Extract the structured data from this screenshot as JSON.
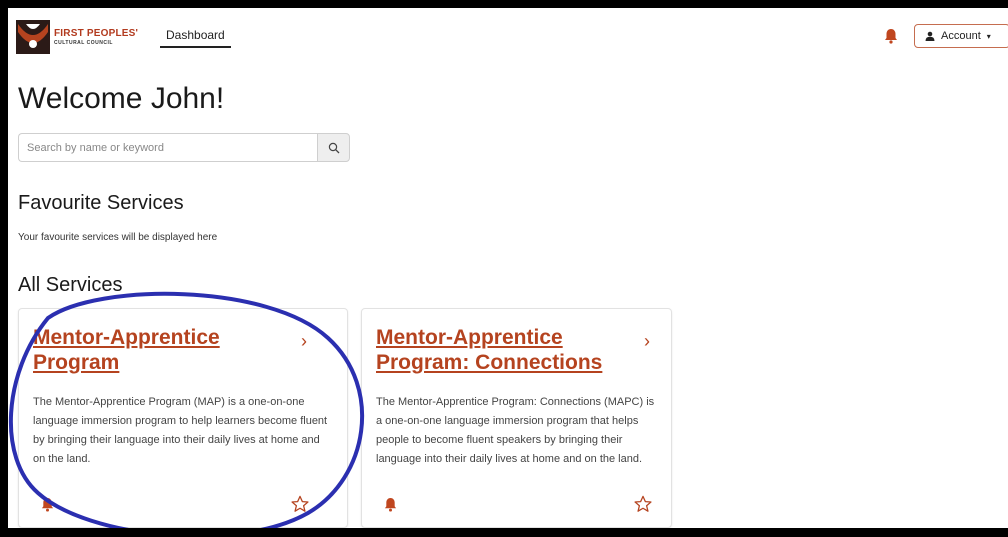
{
  "header": {
    "logo": {
      "line1": "FIRST PEOPLES'",
      "line2": "CULTURAL COUNCIL",
      "accent_color": "#b5431f"
    },
    "nav": {
      "dashboard_label": "Dashboard"
    },
    "notifications_icon": "bell-icon",
    "account": {
      "label": "Account",
      "icon": "person-icon",
      "caret": "▾"
    }
  },
  "welcome": {
    "title": "Welcome John!"
  },
  "search": {
    "placeholder": "Search by name or keyword",
    "value": "",
    "icon": "search-icon"
  },
  "favourites": {
    "title": "Favourite Services",
    "empty_message": "Your favourite services will be displayed here"
  },
  "all_services": {
    "title": "All Services",
    "cards": [
      {
        "title": "Mentor-Apprentice Program",
        "description": "The Mentor-Apprentice Program (MAP) is a one-on-one language immersion program to help learners become fluent by bringing their language into their daily lives at home and on the land.",
        "chevron": "›",
        "bell_icon": "bell-icon",
        "star_icon": "star-outline-icon"
      },
      {
        "title": "Mentor-Apprentice Program: Connections",
        "description": "The Mentor-Apprentice Program: Connections (MAPC) is a one-on-one language immersion program that helps people to become fluent speakers by bringing their language into their daily lives at home and on the land.",
        "chevron": "›",
        "bell_icon": "bell-icon",
        "star_icon": "star-outline-icon"
      }
    ]
  },
  "colors": {
    "brand": "#b5431f",
    "annotation": "#2b2fb0"
  }
}
